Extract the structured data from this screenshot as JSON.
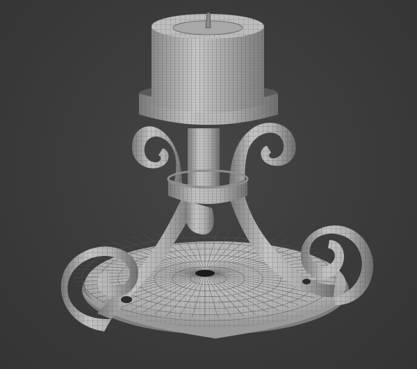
{
  "scene": {
    "subject_icon": "candlestick-wireframe-icon",
    "colors": {
      "background": "#3b3b3b",
      "surface": "#b9b9b9",
      "surface_shadow": "#6f6f6f",
      "wire": "#4a4a4a",
      "wick": "#111111"
    }
  }
}
